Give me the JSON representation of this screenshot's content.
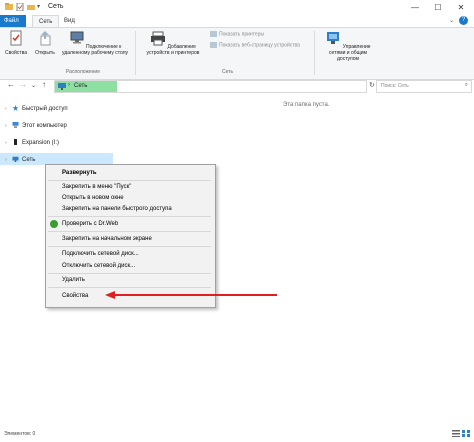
{
  "window": {
    "title": "Сеть",
    "minimize": "—",
    "maximize": "☐",
    "close": "✕"
  },
  "menu": {
    "file": "Файл",
    "tab_network": "Сеть",
    "tab_view": "Вид",
    "help": "?",
    "collapse": "⌄"
  },
  "ribbon": {
    "properties": "Свойства",
    "open": "Открыть",
    "connect_remote": "Подключение к удаленному рабочему столу",
    "group_location": "Расположение",
    "add_devices": "Добавление устройств и принтеров",
    "show_printers": "Показать принтеры",
    "show_web": "Показать веб-страницу устройства",
    "group_network": "Сеть",
    "network_center": "Управление сетями и общим доступом"
  },
  "address": {
    "back": "←",
    "forward": "→",
    "down": "⌄",
    "up": "↑",
    "crumb_arrow": "›",
    "path": "Сеть",
    "refresh": "↻",
    "search_placeholder": "Поиск: Сеть"
  },
  "nav_pane": {
    "items": [
      {
        "label": "Быстрый доступ",
        "icon": "star-icon"
      },
      {
        "label": "Этот компьютер",
        "icon": "computer-icon"
      },
      {
        "label": "Expansion (I:)",
        "icon": "drive-icon"
      },
      {
        "label": "Сеть",
        "icon": "network-icon"
      }
    ]
  },
  "content": {
    "empty_text": "Эта папка пуста."
  },
  "context_menu": {
    "expand": "Развернуть",
    "pin_start_menu": "Закрепить в меню \"Пуск\"",
    "open_new_window": "Открыть в новом окне",
    "pin_quick_access": "Закрепить на панели быстрого доступа",
    "check_drweb": "Проверить с Dr.Web",
    "pin_start_screen": "Закрепить на начальном экране",
    "map_drive": "Подключить сетевой диск...",
    "disconnect_drive": "Отключить сетевой диск...",
    "delete": "Удалить",
    "properties": "Свойства"
  },
  "status_bar": {
    "items_count": "Элементов: 0"
  },
  "colors": {
    "accent": "#1979ca",
    "selection": "#cce8ff",
    "address_highlight": "#8ee0a2",
    "arrow_red": "#e02020"
  }
}
